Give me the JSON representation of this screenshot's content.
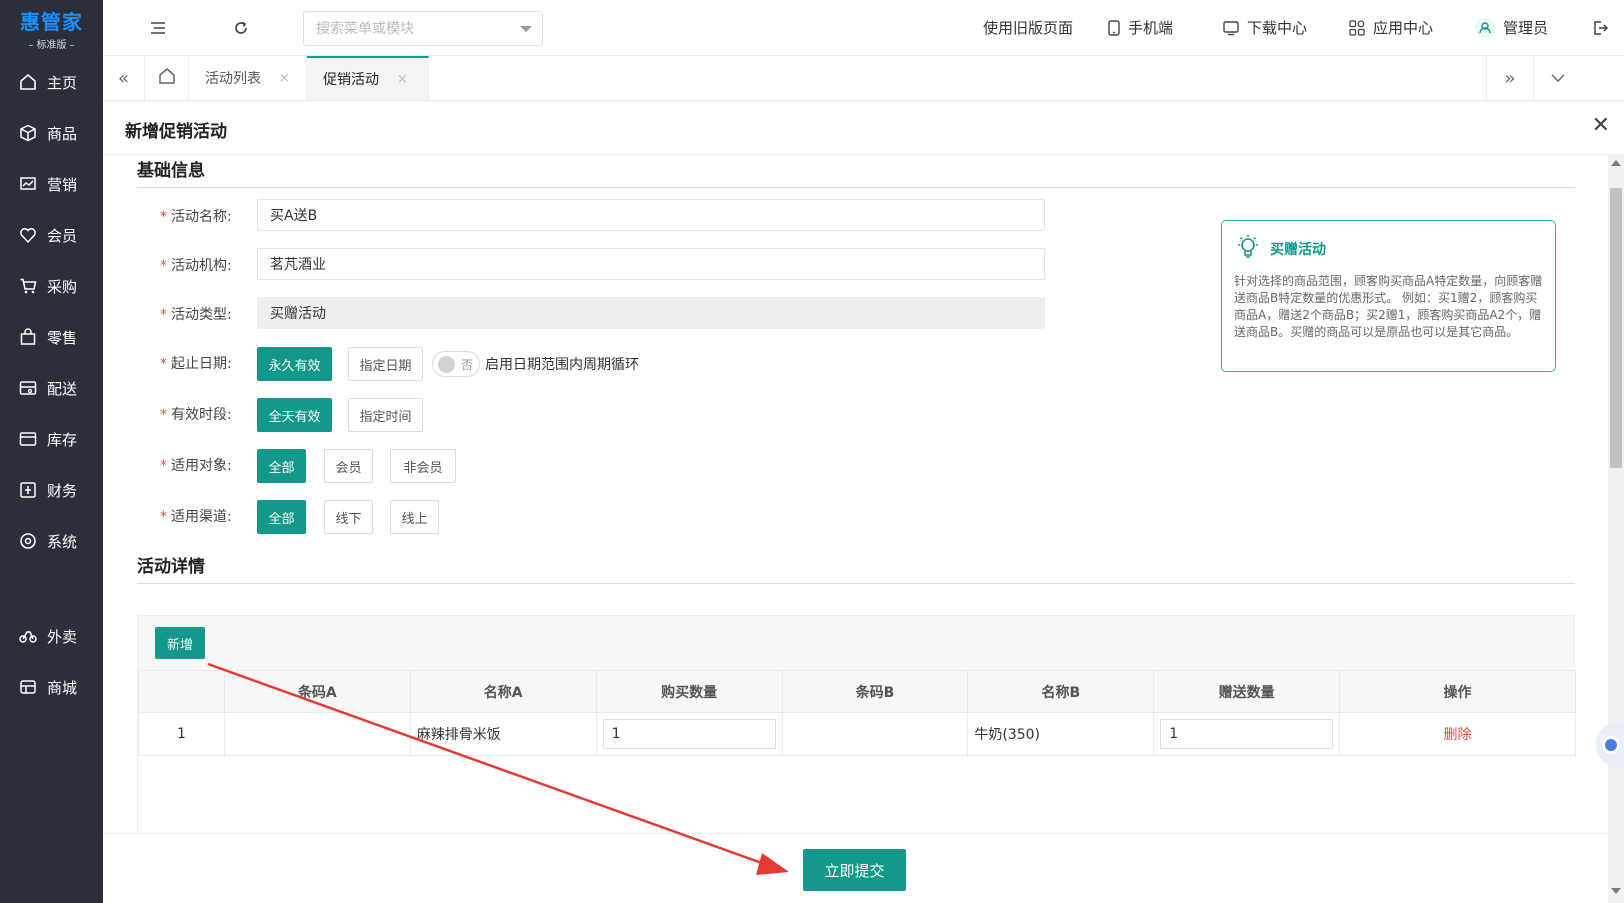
{
  "app": {
    "logo_main": "惠管家",
    "logo_sub": "– 标准版 –"
  },
  "sidebar": {
    "items": [
      {
        "label": "主页",
        "icon": "home-icon"
      },
      {
        "label": "商品",
        "icon": "box-icon"
      },
      {
        "label": "营销",
        "icon": "chart-icon"
      },
      {
        "label": "会员",
        "icon": "heart-icon"
      },
      {
        "label": "采购",
        "icon": "cart-icon"
      },
      {
        "label": "零售",
        "icon": "bag-icon"
      },
      {
        "label": "配送",
        "icon": "truck-icon"
      },
      {
        "label": "库存",
        "icon": "inventory-icon"
      },
      {
        "label": "财务",
        "icon": "finance-icon"
      },
      {
        "label": "系统",
        "icon": "settings-icon"
      },
      {
        "label": "外卖",
        "icon": "bike-icon"
      },
      {
        "label": "商城",
        "icon": "store-icon"
      }
    ]
  },
  "topbar": {
    "search_placeholder": "搜索菜单或模块",
    "links": {
      "old_version": "使用旧版页面",
      "mobile": "手机端",
      "download": "下载中心",
      "apps": "应用中心",
      "user": "管理员"
    }
  },
  "tabs": {
    "list": "活动列表",
    "promo": "促销活动",
    "close_glyph": "×"
  },
  "dialog": {
    "title": "新增促销活动",
    "close_glyph": "✕"
  },
  "basic": {
    "section_title": "基础信息",
    "required_mark": "*",
    "name_label": "活动名称:",
    "name_value": "买A送B",
    "org_label": "活动机构:",
    "org_value": "茗芃酒业",
    "type_label": "活动类型:",
    "type_value": "买赠活动",
    "date_label": "起止日期:",
    "date_opt1": "永久有效",
    "date_opt2": "指定日期",
    "cycle_toggle": "否",
    "cycle_text": "启用日期范围内周期循环",
    "period_label": "有效时段:",
    "period_opt1": "全天有效",
    "period_opt2": "指定时间",
    "target_label": "适用对象:",
    "target_opt1": "全部",
    "target_opt2": "会员",
    "target_opt3": "非会员",
    "channel_label": "适用渠道:",
    "channel_opt1": "全部",
    "channel_opt2": "线下",
    "channel_opt3": "线上"
  },
  "tip": {
    "title": "买赠活动",
    "body": "针对选择的商品范围，顾客购买商品A特定数量，向顾客赠送商品B特定数量的优惠形式。 例如：买1赠2，顾客购买商品A，赠送2个商品B；买2赠1，顾客购买商品A2个，赠送商品B。买赠的商品可以是原品也可以是其它商品。"
  },
  "detail": {
    "section_title": "活动详情",
    "add_button": "新增",
    "columns": [
      "",
      "条码A",
      "名称A",
      "购买数量",
      "条码B",
      "名称B",
      "赠送数量",
      "操作"
    ],
    "rows": [
      {
        "index": "1",
        "barcode_a": "",
        "name_a": "麻辣排骨米饭",
        "buy_qty": "1",
        "barcode_b": "",
        "name_b": "牛奶(350)",
        "gift_qty": "1",
        "action": "删除"
      }
    ]
  },
  "footer": {
    "submit": "立即提交"
  },
  "colors": {
    "accent": "#13988a",
    "sidebar_bg": "#2b2f3a",
    "danger": "#e74c3c",
    "annotation_arrow": "#e53935"
  }
}
